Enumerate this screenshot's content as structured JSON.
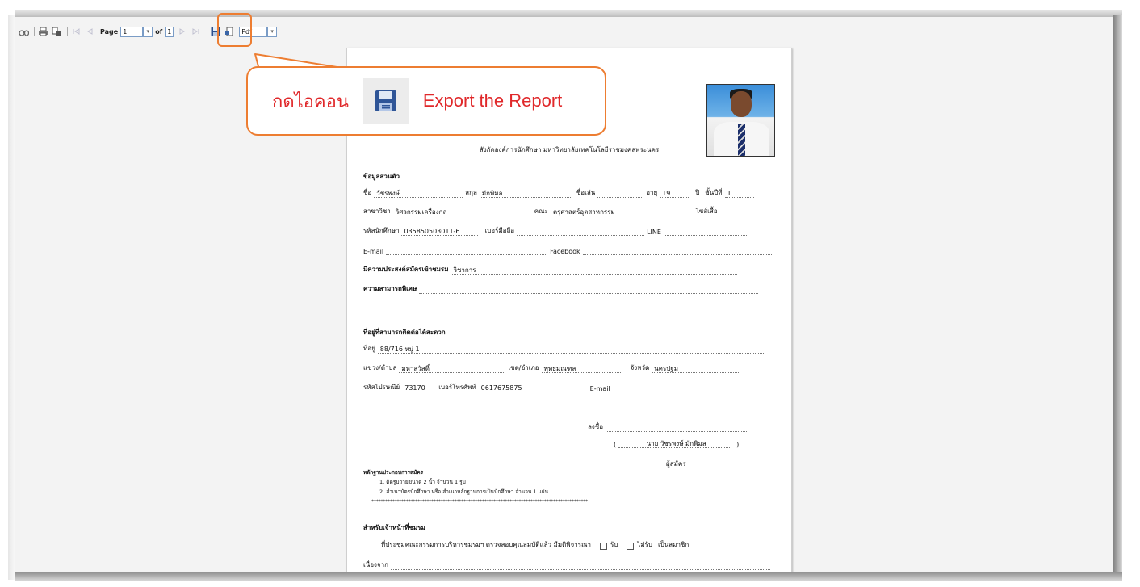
{
  "toolbar": {
    "page_label": "Page",
    "page_value": "1",
    "of_label": "of",
    "total_pages": "1",
    "format_value": "Pdf"
  },
  "callout": {
    "text_th": "กดไอคอน",
    "text_en": "Export the Report"
  },
  "report": {
    "org_line": "สังกัดองค์การนักศึกษา มหาวิทยาลัยเทคโนโลยีราชมงคลพระนคร",
    "section_personal": "ข้อมูลส่วนตัว",
    "name_label": "ชื่อ",
    "name_value": "วัชรพงษ์",
    "surname_label": "สกุล",
    "surname_value": "มักพิมล",
    "nickname_label": "ชื่อเล่น",
    "nickname_value": "",
    "age_label": "อายุ",
    "age_value": "19",
    "age_unit": "ปี",
    "year_label": "ชั้นปีที่",
    "year_value": "1",
    "major_label": "สาขาวิชา",
    "major_value": "วิศวกรรมเครื่องกล",
    "faculty_label": "คณะ",
    "faculty_value": "ครุศาสตร์อุตสาหกรรม",
    "shirt_label": "ไซส์เสื้อ",
    "shirt_value": "",
    "student_id_label": "รหัสนักศึกษา",
    "student_id_value": "035850503011-6",
    "mobile_label": "เบอร์มือถือ",
    "mobile_value": "",
    "line_label": "LINE",
    "line_value": "",
    "email_label": "E-mail",
    "email_value": "",
    "facebook_label": "Facebook",
    "facebook_value": "",
    "intent_label": "มีความประสงค์สมัครเข้าชมรม",
    "intent_value": "วิชาการ",
    "skills_label": "ความสามารถพิเศษ",
    "skills_value": "",
    "section_address": "ที่อยู่ที่สามารถติดต่อได้สะดวก",
    "address_label": "ที่อยู่",
    "address_value": "88/716 หมู่ 1",
    "subdistrict_label": "แขวง/ตำบล",
    "subdistrict_value": "มหาสวัสดิ์",
    "district_label": "เขต/อำเภอ",
    "district_value": "พุทธมณฑล",
    "province_label": "จังหวัด",
    "province_value": "นครปฐม",
    "postal_label": "รหัสไปรษณีย์",
    "postal_value": "73170",
    "phone_label": "เบอร์โทรศัพท์",
    "phone_value": "0617675875",
    "email2_label": "E-mail",
    "email2_value": "",
    "sign_label": "ลงชื่อ",
    "sign_open": "(",
    "sign_name": "นาย วัชรพงษ์ มักพิมล",
    "sign_close": ")",
    "applicant_label": "ผู้สมัคร",
    "evidence_title": "หลักฐานประกอบการสมัคร",
    "evidence_1": "1. ติดรูปถ่ายขนาด 2 นิ้ว จำนวน 1 รูป",
    "evidence_2": "2. สำเนาบัตรนักศึกษา หรือ สำเนาหลักฐานการเป็นนักศึกษา จำนวน 1 แผ่น",
    "star_line": "**********************************************************************************************",
    "staff_title": "สำหรับเจ้าหน้าที่ชมรม",
    "staff_text": "ที่ประชุมคณะกรรมการบริหารชมรมฯ ตรวจสอบคุณสมบัติแล้ว มีมติพิจารณา",
    "accept_label": "รับ",
    "reject_label": "ไม่รับ",
    "member_label": "เป็นสมาชิก",
    "reason_label": "เนื่องจาก"
  }
}
